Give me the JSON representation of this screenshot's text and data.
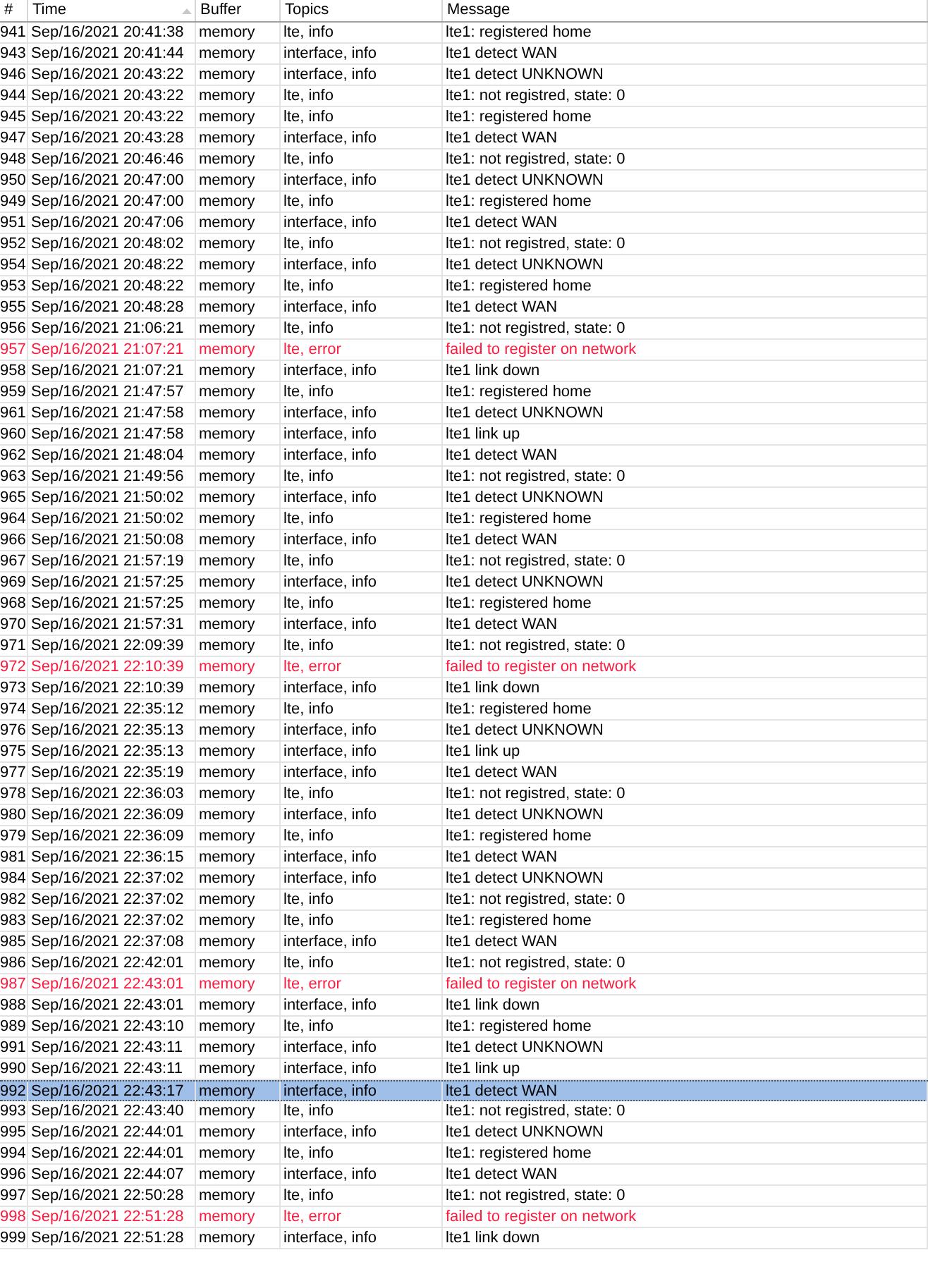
{
  "columns": [
    {
      "label": "#",
      "sorted": false
    },
    {
      "label": "Time",
      "sorted": true
    },
    {
      "label": "Buffer",
      "sorted": false
    },
    {
      "label": "Topics",
      "sorted": false
    },
    {
      "label": "Message",
      "sorted": false
    }
  ],
  "rows": [
    {
      "num": "941",
      "time": "Sep/16/2021 20:41:38",
      "buffer": "memory",
      "topics": "lte, info",
      "message": "lte1: registered home",
      "error": false,
      "selected": false
    },
    {
      "num": "943",
      "time": "Sep/16/2021 20:41:44",
      "buffer": "memory",
      "topics": "interface, info",
      "message": "lte1 detect WAN",
      "error": false,
      "selected": false
    },
    {
      "num": "946",
      "time": "Sep/16/2021 20:43:22",
      "buffer": "memory",
      "topics": "interface, info",
      "message": "lte1 detect UNKNOWN",
      "error": false,
      "selected": false
    },
    {
      "num": "944",
      "time": "Sep/16/2021 20:43:22",
      "buffer": "memory",
      "topics": "lte, info",
      "message": "lte1: not registred, state: 0",
      "error": false,
      "selected": false
    },
    {
      "num": "945",
      "time": "Sep/16/2021 20:43:22",
      "buffer": "memory",
      "topics": "lte, info",
      "message": "lte1: registered home",
      "error": false,
      "selected": false
    },
    {
      "num": "947",
      "time": "Sep/16/2021 20:43:28",
      "buffer": "memory",
      "topics": "interface, info",
      "message": "lte1 detect WAN",
      "error": false,
      "selected": false
    },
    {
      "num": "948",
      "time": "Sep/16/2021 20:46:46",
      "buffer": "memory",
      "topics": "lte, info",
      "message": "lte1: not registred, state: 0",
      "error": false,
      "selected": false
    },
    {
      "num": "950",
      "time": "Sep/16/2021 20:47:00",
      "buffer": "memory",
      "topics": "interface, info",
      "message": "lte1 detect UNKNOWN",
      "error": false,
      "selected": false
    },
    {
      "num": "949",
      "time": "Sep/16/2021 20:47:00",
      "buffer": "memory",
      "topics": "lte, info",
      "message": "lte1: registered home",
      "error": false,
      "selected": false
    },
    {
      "num": "951",
      "time": "Sep/16/2021 20:47:06",
      "buffer": "memory",
      "topics": "interface, info",
      "message": "lte1 detect WAN",
      "error": false,
      "selected": false
    },
    {
      "num": "952",
      "time": "Sep/16/2021 20:48:02",
      "buffer": "memory",
      "topics": "lte, info",
      "message": "lte1: not registred, state: 0",
      "error": false,
      "selected": false
    },
    {
      "num": "954",
      "time": "Sep/16/2021 20:48:22",
      "buffer": "memory",
      "topics": "interface, info",
      "message": "lte1 detect UNKNOWN",
      "error": false,
      "selected": false
    },
    {
      "num": "953",
      "time": "Sep/16/2021 20:48:22",
      "buffer": "memory",
      "topics": "lte, info",
      "message": "lte1: registered home",
      "error": false,
      "selected": false
    },
    {
      "num": "955",
      "time": "Sep/16/2021 20:48:28",
      "buffer": "memory",
      "topics": "interface, info",
      "message": "lte1 detect WAN",
      "error": false,
      "selected": false
    },
    {
      "num": "956",
      "time": "Sep/16/2021 21:06:21",
      "buffer": "memory",
      "topics": "lte, info",
      "message": "lte1: not registred, state: 0",
      "error": false,
      "selected": false
    },
    {
      "num": "957",
      "time": "Sep/16/2021 21:07:21",
      "buffer": "memory",
      "topics": "lte, error",
      "message": "failed to register on network",
      "error": true,
      "selected": false
    },
    {
      "num": "958",
      "time": "Sep/16/2021 21:07:21",
      "buffer": "memory",
      "topics": "interface, info",
      "message": "lte1 link down",
      "error": false,
      "selected": false
    },
    {
      "num": "959",
      "time": "Sep/16/2021 21:47:57",
      "buffer": "memory",
      "topics": "lte, info",
      "message": "lte1: registered home",
      "error": false,
      "selected": false
    },
    {
      "num": "961",
      "time": "Sep/16/2021 21:47:58",
      "buffer": "memory",
      "topics": "interface, info",
      "message": "lte1 detect UNKNOWN",
      "error": false,
      "selected": false
    },
    {
      "num": "960",
      "time": "Sep/16/2021 21:47:58",
      "buffer": "memory",
      "topics": "interface, info",
      "message": "lte1 link up",
      "error": false,
      "selected": false
    },
    {
      "num": "962",
      "time": "Sep/16/2021 21:48:04",
      "buffer": "memory",
      "topics": "interface, info",
      "message": "lte1 detect WAN",
      "error": false,
      "selected": false
    },
    {
      "num": "963",
      "time": "Sep/16/2021 21:49:56",
      "buffer": "memory",
      "topics": "lte, info",
      "message": "lte1: not registred, state: 0",
      "error": false,
      "selected": false
    },
    {
      "num": "965",
      "time": "Sep/16/2021 21:50:02",
      "buffer": "memory",
      "topics": "interface, info",
      "message": "lte1 detect UNKNOWN",
      "error": false,
      "selected": false
    },
    {
      "num": "964",
      "time": "Sep/16/2021 21:50:02",
      "buffer": "memory",
      "topics": "lte, info",
      "message": "lte1: registered home",
      "error": false,
      "selected": false
    },
    {
      "num": "966",
      "time": "Sep/16/2021 21:50:08",
      "buffer": "memory",
      "topics": "interface, info",
      "message": "lte1 detect WAN",
      "error": false,
      "selected": false
    },
    {
      "num": "967",
      "time": "Sep/16/2021 21:57:19",
      "buffer": "memory",
      "topics": "lte, info",
      "message": "lte1: not registred, state: 0",
      "error": false,
      "selected": false
    },
    {
      "num": "969",
      "time": "Sep/16/2021 21:57:25",
      "buffer": "memory",
      "topics": "interface, info",
      "message": "lte1 detect UNKNOWN",
      "error": false,
      "selected": false
    },
    {
      "num": "968",
      "time": "Sep/16/2021 21:57:25",
      "buffer": "memory",
      "topics": "lte, info",
      "message": "lte1: registered home",
      "error": false,
      "selected": false
    },
    {
      "num": "970",
      "time": "Sep/16/2021 21:57:31",
      "buffer": "memory",
      "topics": "interface, info",
      "message": "lte1 detect WAN",
      "error": false,
      "selected": false
    },
    {
      "num": "971",
      "time": "Sep/16/2021 22:09:39",
      "buffer": "memory",
      "topics": "lte, info",
      "message": "lte1: not registred, state: 0",
      "error": false,
      "selected": false
    },
    {
      "num": "972",
      "time": "Sep/16/2021 22:10:39",
      "buffer": "memory",
      "topics": "lte, error",
      "message": "failed to register on network",
      "error": true,
      "selected": false
    },
    {
      "num": "973",
      "time": "Sep/16/2021 22:10:39",
      "buffer": "memory",
      "topics": "interface, info",
      "message": "lte1 link down",
      "error": false,
      "selected": false
    },
    {
      "num": "974",
      "time": "Sep/16/2021 22:35:12",
      "buffer": "memory",
      "topics": "lte, info",
      "message": "lte1: registered home",
      "error": false,
      "selected": false
    },
    {
      "num": "976",
      "time": "Sep/16/2021 22:35:13",
      "buffer": "memory",
      "topics": "interface, info",
      "message": "lte1 detect UNKNOWN",
      "error": false,
      "selected": false
    },
    {
      "num": "975",
      "time": "Sep/16/2021 22:35:13",
      "buffer": "memory",
      "topics": "interface, info",
      "message": "lte1 link up",
      "error": false,
      "selected": false
    },
    {
      "num": "977",
      "time": "Sep/16/2021 22:35:19",
      "buffer": "memory",
      "topics": "interface, info",
      "message": "lte1 detect WAN",
      "error": false,
      "selected": false
    },
    {
      "num": "978",
      "time": "Sep/16/2021 22:36:03",
      "buffer": "memory",
      "topics": "lte, info",
      "message": "lte1: not registred, state: 0",
      "error": false,
      "selected": false
    },
    {
      "num": "980",
      "time": "Sep/16/2021 22:36:09",
      "buffer": "memory",
      "topics": "interface, info",
      "message": "lte1 detect UNKNOWN",
      "error": false,
      "selected": false
    },
    {
      "num": "979",
      "time": "Sep/16/2021 22:36:09",
      "buffer": "memory",
      "topics": "lte, info",
      "message": "lte1: registered home",
      "error": false,
      "selected": false
    },
    {
      "num": "981",
      "time": "Sep/16/2021 22:36:15",
      "buffer": "memory",
      "topics": "interface, info",
      "message": "lte1 detect WAN",
      "error": false,
      "selected": false
    },
    {
      "num": "984",
      "time": "Sep/16/2021 22:37:02",
      "buffer": "memory",
      "topics": "interface, info",
      "message": "lte1 detect UNKNOWN",
      "error": false,
      "selected": false
    },
    {
      "num": "982",
      "time": "Sep/16/2021 22:37:02",
      "buffer": "memory",
      "topics": "lte, info",
      "message": "lte1: not registred, state: 0",
      "error": false,
      "selected": false
    },
    {
      "num": "983",
      "time": "Sep/16/2021 22:37:02",
      "buffer": "memory",
      "topics": "lte, info",
      "message": "lte1: registered home",
      "error": false,
      "selected": false
    },
    {
      "num": "985",
      "time": "Sep/16/2021 22:37:08",
      "buffer": "memory",
      "topics": "interface, info",
      "message": "lte1 detect WAN",
      "error": false,
      "selected": false
    },
    {
      "num": "986",
      "time": "Sep/16/2021 22:42:01",
      "buffer": "memory",
      "topics": "lte, info",
      "message": "lte1: not registred, state: 0",
      "error": false,
      "selected": false
    },
    {
      "num": "987",
      "time": "Sep/16/2021 22:43:01",
      "buffer": "memory",
      "topics": "lte, error",
      "message": "failed to register on network",
      "error": true,
      "selected": false
    },
    {
      "num": "988",
      "time": "Sep/16/2021 22:43:01",
      "buffer": "memory",
      "topics": "interface, info",
      "message": "lte1 link down",
      "error": false,
      "selected": false
    },
    {
      "num": "989",
      "time": "Sep/16/2021 22:43:10",
      "buffer": "memory",
      "topics": "lte, info",
      "message": "lte1: registered home",
      "error": false,
      "selected": false
    },
    {
      "num": "991",
      "time": "Sep/16/2021 22:43:11",
      "buffer": "memory",
      "topics": "interface, info",
      "message": "lte1 detect UNKNOWN",
      "error": false,
      "selected": false
    },
    {
      "num": "990",
      "time": "Sep/16/2021 22:43:11",
      "buffer": "memory",
      "topics": "interface, info",
      "message": "lte1 link up",
      "error": false,
      "selected": false
    },
    {
      "num": "992",
      "time": "Sep/16/2021 22:43:17",
      "buffer": "memory",
      "topics": "interface, info",
      "message": "lte1 detect WAN",
      "error": false,
      "selected": true
    },
    {
      "num": "993",
      "time": "Sep/16/2021 22:43:40",
      "buffer": "memory",
      "topics": "lte, info",
      "message": "lte1: not registred, state: 0",
      "error": false,
      "selected": false
    },
    {
      "num": "995",
      "time": "Sep/16/2021 22:44:01",
      "buffer": "memory",
      "topics": "interface, info",
      "message": "lte1 detect UNKNOWN",
      "error": false,
      "selected": false
    },
    {
      "num": "994",
      "time": "Sep/16/2021 22:44:01",
      "buffer": "memory",
      "topics": "lte, info",
      "message": "lte1: registered home",
      "error": false,
      "selected": false
    },
    {
      "num": "996",
      "time": "Sep/16/2021 22:44:07",
      "buffer": "memory",
      "topics": "interface, info",
      "message": "lte1 detect WAN",
      "error": false,
      "selected": false
    },
    {
      "num": "997",
      "time": "Sep/16/2021 22:50:28",
      "buffer": "memory",
      "topics": "lte, info",
      "message": "lte1: not registred, state: 0",
      "error": false,
      "selected": false
    },
    {
      "num": "998",
      "time": "Sep/16/2021 22:51:28",
      "buffer": "memory",
      "topics": "lte, error",
      "message": "failed to register on network",
      "error": true,
      "selected": false
    },
    {
      "num": "999",
      "time": "Sep/16/2021 22:51:28",
      "buffer": "memory",
      "topics": "interface, info",
      "message": "lte1 link down",
      "error": false,
      "selected": false
    }
  ]
}
